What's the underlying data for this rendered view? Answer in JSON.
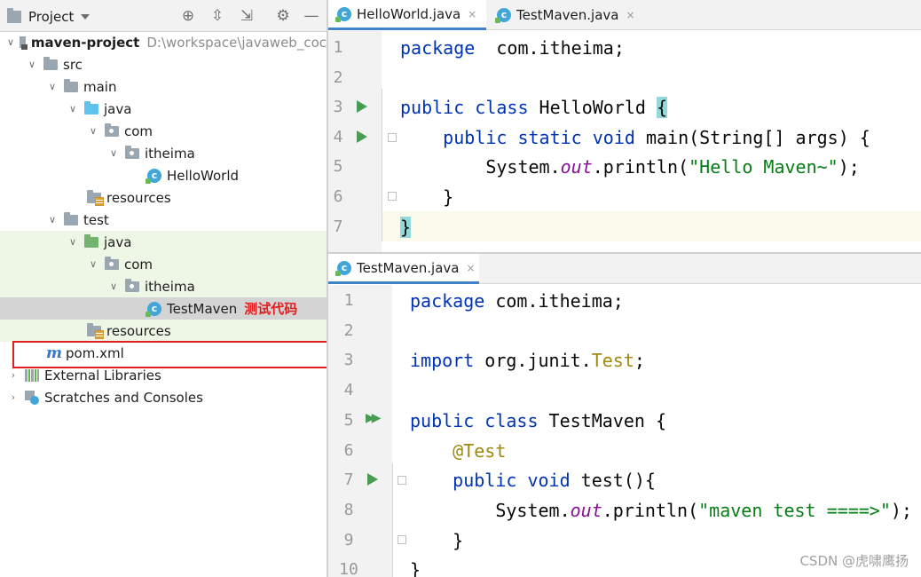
{
  "project_panel": {
    "title": "Project",
    "tree": [
      {
        "label": "maven-project",
        "hint": "D:\\workspace\\javaweb_coc"
      },
      {
        "label": "src"
      },
      {
        "label": "main"
      },
      {
        "label": "java"
      },
      {
        "label": "com"
      },
      {
        "label": "itheima"
      },
      {
        "label": "HelloWorld"
      },
      {
        "label": "resources"
      },
      {
        "label": "test"
      },
      {
        "label": "java"
      },
      {
        "label": "com"
      },
      {
        "label": "itheima"
      },
      {
        "label": "TestMaven",
        "annotation": "测试代码"
      },
      {
        "label": "resources"
      },
      {
        "label": "pom.xml"
      },
      {
        "label": "External Libraries"
      },
      {
        "label": "Scratches and Consoles"
      }
    ]
  },
  "top_editor": {
    "tabs": [
      {
        "label": "HelloWorld.java",
        "close": "×"
      },
      {
        "label": "TestMaven.java",
        "close": "×"
      }
    ],
    "lines": [
      {
        "n": "1",
        "parts": [
          [
            "kw",
            "package"
          ],
          [
            "",
            "  com.itheima;"
          ]
        ]
      },
      {
        "n": "2",
        "parts": []
      },
      {
        "n": "3",
        "parts": [
          [
            "kw",
            "public class"
          ],
          [
            "",
            " HelloWorld "
          ],
          [
            "brace",
            "{"
          ]
        ]
      },
      {
        "n": "4",
        "parts": [
          [
            "",
            "    "
          ],
          [
            "kw",
            "public static void"
          ],
          [
            "",
            " main(String[] args) {"
          ]
        ]
      },
      {
        "n": "5",
        "parts": [
          [
            "",
            "        System."
          ],
          [
            "fld",
            "out"
          ],
          [
            "",
            ".println("
          ],
          [
            "str",
            "\"Hello Maven~\""
          ],
          [
            "",
            ");"
          ]
        ]
      },
      {
        "n": "6",
        "parts": [
          [
            "",
            "    }"
          ]
        ]
      },
      {
        "n": "7",
        "parts": [
          [
            "brace",
            "}"
          ]
        ]
      }
    ]
  },
  "bottom_editor": {
    "tabs": [
      {
        "label": "TestMaven.java",
        "close": "×"
      }
    ],
    "lines": [
      {
        "n": "1",
        "parts": [
          [
            "kw",
            "package"
          ],
          [
            "",
            " com.itheima;"
          ]
        ]
      },
      {
        "n": "2",
        "parts": []
      },
      {
        "n": "3",
        "parts": [
          [
            "kw",
            "import"
          ],
          [
            "",
            " org.junit."
          ],
          [
            "ann",
            "Test"
          ],
          [
            "",
            ";"
          ]
        ]
      },
      {
        "n": "4",
        "parts": []
      },
      {
        "n": "5",
        "parts": [
          [
            "kw",
            "public class"
          ],
          [
            "",
            " TestMaven {"
          ]
        ]
      },
      {
        "n": "6",
        "parts": [
          [
            "",
            "    "
          ],
          [
            "ann",
            "@Test"
          ]
        ]
      },
      {
        "n": "7",
        "parts": [
          [
            "",
            "    "
          ],
          [
            "kw",
            "public void"
          ],
          [
            "",
            " test(){"
          ]
        ]
      },
      {
        "n": "8",
        "parts": [
          [
            "",
            "        System."
          ],
          [
            "fld",
            "out"
          ],
          [
            "",
            ".println("
          ],
          [
            "str",
            "\"maven test ====>\""
          ],
          [
            "",
            ");"
          ]
        ]
      },
      {
        "n": "9",
        "parts": [
          [
            "",
            "    }"
          ]
        ]
      },
      {
        "n": "10",
        "parts": [
          [
            "",
            "}"
          ]
        ]
      }
    ]
  },
  "watermark": "CSDN @虎啸鹰扬"
}
